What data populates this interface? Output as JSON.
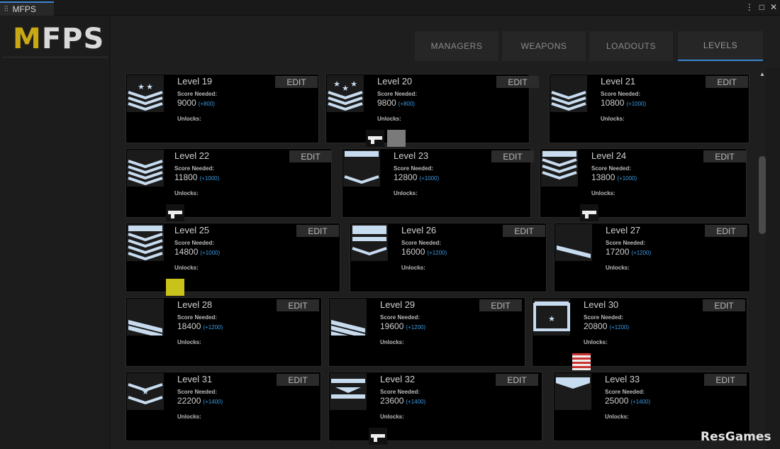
{
  "window": {
    "tab_title": "MFPS",
    "tab_icon": "sliders-icon"
  },
  "logo": {
    "m": "M",
    "rest": "FPS"
  },
  "nav": {
    "tabs": [
      "MANAGERS",
      "WEAPONS",
      "LOADOUTS",
      "LEVELS"
    ],
    "active": "LEVELS"
  },
  "labels": {
    "score_needed": "Score Needed:",
    "unlocks": "Unlocks:",
    "edit": "EDIT"
  },
  "levels": [
    {
      "name": "Level 19",
      "score": "9000",
      "inc": "(+800)",
      "badge": "chevrons-3-stars-2",
      "unlocks": []
    },
    {
      "name": "Level 20",
      "score": "9800",
      "inc": "(+800)",
      "badge": "chevrons-3-stars-3",
      "unlocks": [
        "weapon-icon",
        "camo-icon"
      ]
    },
    {
      "name": "Level 21",
      "score": "10800",
      "inc": "(+1000)",
      "badge": "chevrons-3",
      "unlocks": []
    },
    {
      "name": "Level 22",
      "score": "11800",
      "inc": "(+1000)",
      "badge": "chevrons-4",
      "unlocks": [
        "weapon-icon"
      ]
    },
    {
      "name": "Level 23",
      "score": "12800",
      "inc": "(+1000)",
      "badge": "bar-chevron",
      "unlocks": []
    },
    {
      "name": "Level 24",
      "score": "13800",
      "inc": "(+1000)",
      "badge": "bar-chevrons-3",
      "unlocks": [
        "pistol-icon"
      ]
    },
    {
      "name": "Level 25",
      "score": "14800",
      "inc": "(+1000)",
      "badge": "bar-chevrons-4",
      "unlocks": [
        "camo-icon"
      ]
    },
    {
      "name": "Level 26",
      "score": "16000",
      "inc": "(+1200)",
      "badge": "bars-chevron",
      "unlocks": []
    },
    {
      "name": "Level 27",
      "score": "17200",
      "inc": "(+1200)",
      "badge": "diag-1",
      "unlocks": []
    },
    {
      "name": "Level 28",
      "score": "18400",
      "inc": "(+1200)",
      "badge": "diag-2",
      "unlocks": []
    },
    {
      "name": "Level 29",
      "score": "19600",
      "inc": "(+1200)",
      "badge": "diag-3",
      "unlocks": []
    },
    {
      "name": "Level 30",
      "score": "20800",
      "inc": "(+1200)",
      "badge": "box-star",
      "unlocks": [
        "flag-icon"
      ]
    },
    {
      "name": "Level 31",
      "score": "22200",
      "inc": "(+1400)",
      "badge": "chevron-star",
      "unlocks": []
    },
    {
      "name": "Level 32",
      "score": "23600",
      "inc": "(+1400)",
      "badge": "bar-triangle",
      "unlocks": [
        "weapon-icon"
      ]
    },
    {
      "name": "Level 33",
      "score": "25000",
      "inc": "(+1400)",
      "badge": "shield",
      "unlocks": []
    }
  ],
  "watermark": "ResGames",
  "colors": {
    "accent": "#3a86d0",
    "logo_m": "#c9a816",
    "increment": "#3a9ae0",
    "badge": "#c8dcf0"
  }
}
